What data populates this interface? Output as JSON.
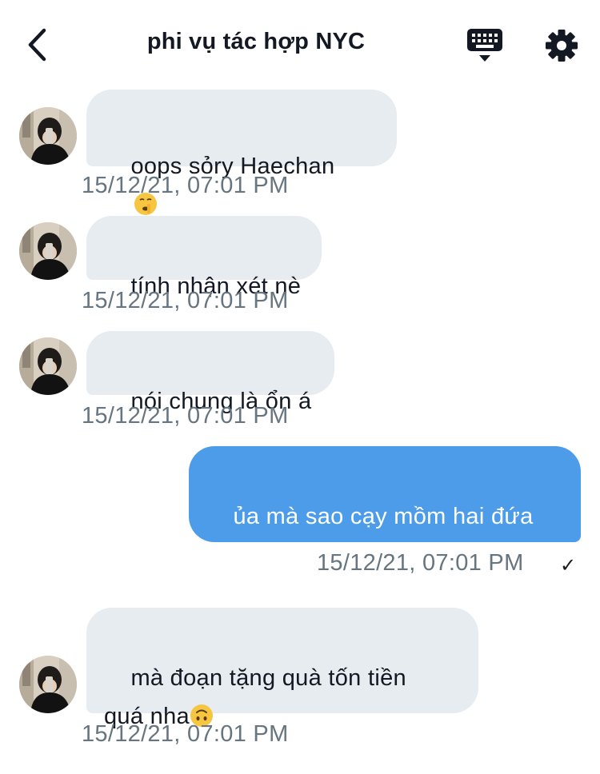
{
  "header": {
    "title": "phi vụ tác hợp NYC",
    "back_icon": "chevron-left-icon",
    "keyboard_icon": "keyboard-icon",
    "settings_icon": "gear-icon"
  },
  "colors": {
    "incoming_bubble": "#e6ecf0",
    "outgoing_bubble": "#4c9ce9",
    "timestamp": "#66757f"
  },
  "messages": [
    {
      "direction": "incoming",
      "text": "oops sỏry Haechan",
      "emoji": "shushing-face-icon",
      "time": "15/12/21, 07:01 PM"
    },
    {
      "direction": "incoming",
      "text": "tính nhận xét nè",
      "time": "15/12/21, 07:01 PM"
    },
    {
      "direction": "incoming",
      "text": "nói chung là ổn á",
      "time": "15/12/21, 07:01 PM"
    },
    {
      "direction": "outgoing",
      "text": "ủa mà sao cạy mồm hai đứa\nkia?:))",
      "time": "15/12/21, 07:01 PM",
      "status": "✓"
    },
    {
      "direction": "incoming",
      "text": "mà đoạn tặng quà tốn tiền\nquá nha",
      "emoji": "upside-down-face-icon",
      "time": "15/12/21, 07:01 PM"
    }
  ]
}
